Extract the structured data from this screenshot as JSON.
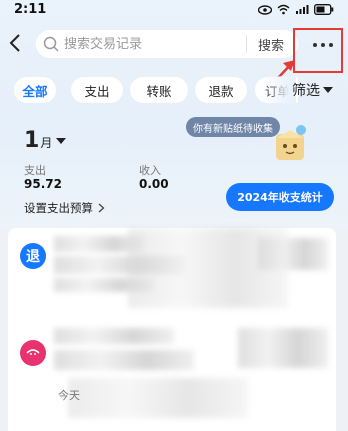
{
  "status_bar": {
    "time": "2:11"
  },
  "search": {
    "placeholder": "搜索交易记录",
    "button_label": "搜索"
  },
  "tabs": [
    {
      "label": "全部",
      "active": true
    },
    {
      "label": "支出",
      "active": false
    },
    {
      "label": "转账",
      "active": false
    },
    {
      "label": "退款",
      "active": false
    },
    {
      "label": "订单",
      "active": false
    }
  ],
  "filter_label": "筛选",
  "summary": {
    "month": "1",
    "month_unit": "月",
    "expense_label": "支出",
    "expense_value": "95.72",
    "income_label": "收入",
    "income_value": "0.00",
    "budget_label": "设置支出预算"
  },
  "sticker_tip": "你有新贴纸待收集",
  "stats_button": "2024年收支统计",
  "transactions": [
    {
      "icon_text": "退",
      "icon_color": "#1677ff"
    },
    {
      "icon_color": "#e8336f",
      "date_text": "今天"
    }
  ],
  "colors": {
    "accent": "#1677ff",
    "annotation": "#e53935"
  }
}
